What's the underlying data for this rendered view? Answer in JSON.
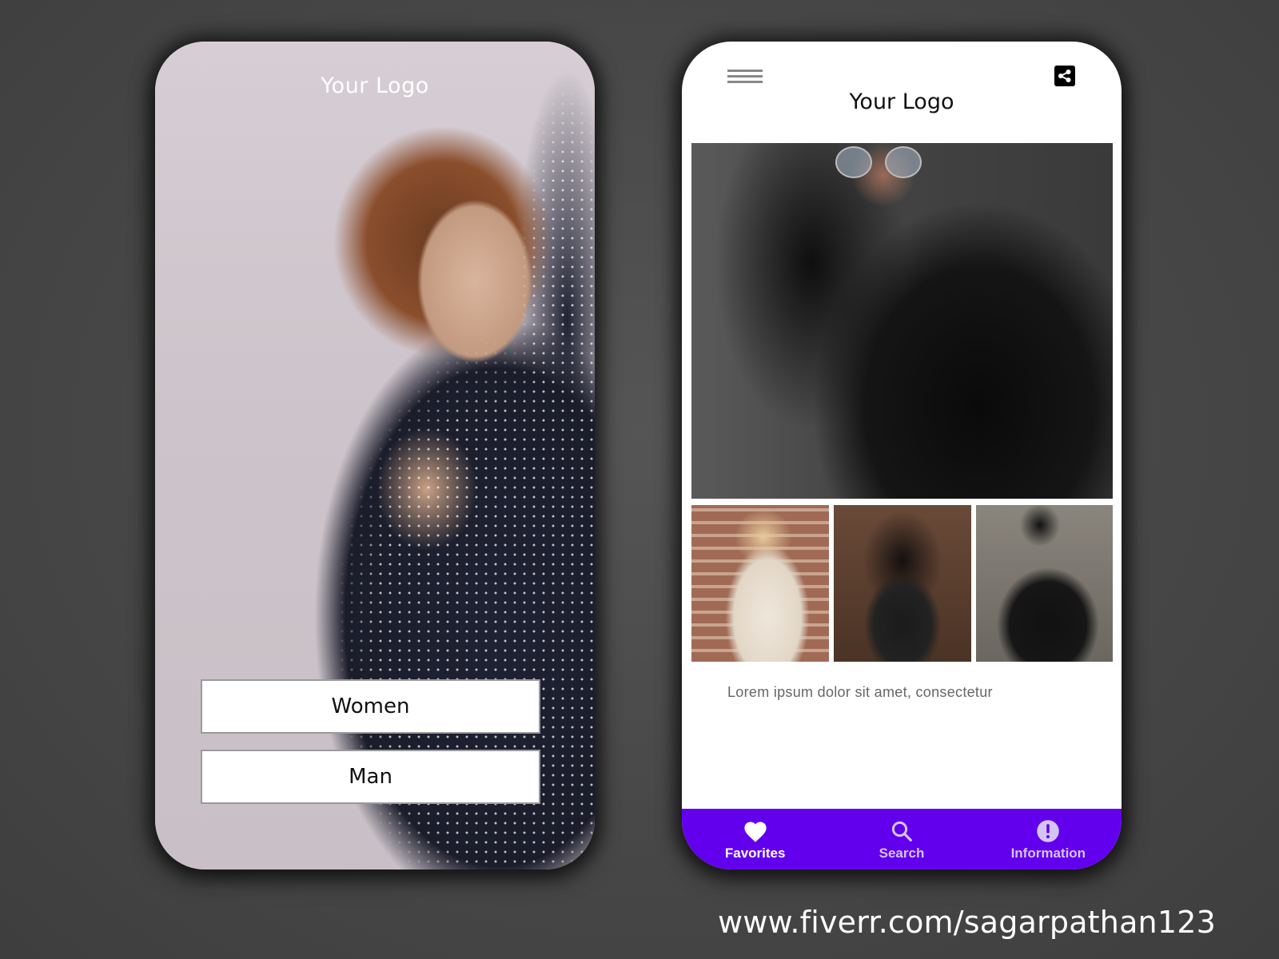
{
  "left_screen": {
    "logo": "Your Logo",
    "buttons": [
      {
        "label": "Women"
      },
      {
        "label": "Man"
      }
    ]
  },
  "right_screen": {
    "header": {
      "menu_icon": "hamburger-menu-icon",
      "share_icon": "share-icon",
      "logo": "Your Logo"
    },
    "gallery": {
      "hero": "photo",
      "thumbnails": [
        "photo",
        "photo",
        "photo"
      ]
    },
    "description": "Lorem ipsum dolor sit amet, consectetur",
    "bottom_nav": {
      "background": "#6200ee",
      "items": [
        {
          "label": "Favorites",
          "icon": "heart-icon",
          "active": true
        },
        {
          "label": "Search",
          "icon": "search-icon",
          "active": false
        },
        {
          "label": "Information",
          "icon": "info-icon",
          "active": false
        }
      ]
    }
  },
  "footer": {
    "url": "www.fiverr.com/sagarpathan123"
  }
}
